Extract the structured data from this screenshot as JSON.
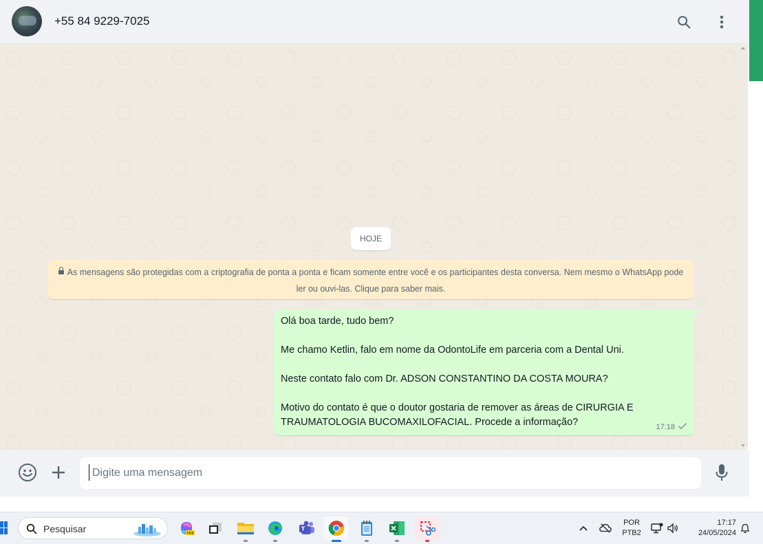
{
  "header": {
    "contact_name": "+55 84 9229-7025",
    "search_icon": "search-icon",
    "menu_icon": "kebab-menu-icon"
  },
  "chat": {
    "date_label": "HOJE",
    "encryption_notice": "As mensagens são protegidas com a criptografia de ponta a ponta e ficam somente entre você e os participantes desta conversa. Nem mesmo o WhatsApp pode ler ou ouvi-las. Clique para saber mais.",
    "message": {
      "paragraphs": [
        "Olá boa tarde, tudo bem?",
        "Me chamo Ketlin, falo em nome da OdontoLife em parceria com a Dental Uni.",
        "Neste contato falo com Dr. ADSON CONSTANTINO DA COSTA MOURA?",
        "Motivo do contato é que o doutor gostaria de remover as áreas de CIRURGIA E TRAUMATOLOGIA BUCOMAXILOFACIAL. Procede a informação?"
      ],
      "time": "17:18",
      "status_icon": "single-check-icon"
    }
  },
  "composer": {
    "placeholder": "Digite uma mensagem",
    "emoji_icon": "emoji-icon",
    "attach_icon": "plus-icon",
    "mic_icon": "microphone-icon"
  },
  "taskbar": {
    "search_label": "Pesquisar",
    "language_line1": "POR",
    "language_line2": "PTB2",
    "time": "17:17",
    "date": "24/05/2024"
  },
  "colors": {
    "outgoing_bubble": "#d9fdd3",
    "chat_background": "#efeae2",
    "notice_background": "#ffeecd",
    "accent_green": "#25a166"
  }
}
